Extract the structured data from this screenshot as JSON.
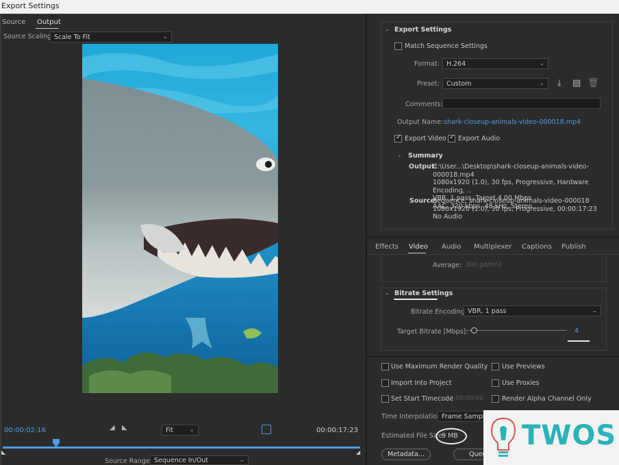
{
  "window": {
    "title": "Export Settings"
  },
  "source_panel": {
    "tabs": [
      "Source",
      "Output"
    ],
    "source_scaling_label": "Source Scaling:",
    "source_scaling_value": "Scale To Fit",
    "timecode_current": "00:00:02:16",
    "fit_value": "Fit",
    "timecode_end": "00:00:17:23",
    "source_range_label": "Source Range:",
    "source_range_value": "Sequence In/Out",
    "playhead_fraction": 0.15
  },
  "export_settings": {
    "header": "Export Settings",
    "match_sequence_settings": "Match Sequence Settings",
    "format_label": "Format:",
    "format_value": "H.264",
    "preset_label": "Preset:",
    "preset_value": "Custom",
    "comments_label": "Comments:",
    "comments_value": "",
    "output_name_label": "Output Name:",
    "output_name_value": "shark-closeup-animals-video-000018.mp4",
    "export_video_label": "Export Video",
    "export_video_checked": true,
    "export_audio_label": "Export Audio",
    "export_audio_checked": true,
    "summary_header": "Summary",
    "summary_output_label": "Output:",
    "summary_output_lines": [
      "C:\\User...\\Desktop\\shark-closeup-animals-video-000018.mp4",
      "1080x1920 (1.0), 30 fps, Progressive, Hardware Encoding, ..",
      "VBR, 1 pass, Target 4.00 Mbps",
      "AAC, 320 kbps, 48 kHz, Stereo"
    ],
    "summary_source_label": "Source:",
    "summary_source_lines": [
      "Sequence, shark-closeup-animals-video-000018",
      "1080x1920 (1.0), 30 fps, Progressive, 00:00:17:23",
      "No Audio"
    ]
  },
  "settings_tabs": [
    "Effects",
    "Video",
    "Audio",
    "Multiplexer",
    "Captions",
    "Publish"
  ],
  "video_settings": {
    "average_label": "Average:",
    "average_value": "300 gd/m²2",
    "bitrate_header": "Bitrate Settings",
    "bitrate_encoding_label": "Bitrate Encoding:",
    "bitrate_encoding_value": "VBR, 1 pass",
    "target_bitrate_label": "Target Bitrate [Mbps]:",
    "target_bitrate_value": "4"
  },
  "bottom_options": {
    "use_max_render_quality": "Use Maximum Render Quality",
    "use_previews": "Use Previews",
    "import_into_project": "Import Into Project",
    "use_proxies": "Use Proxies",
    "set_start_timecode": "Set Start Timecode",
    "start_timecode_value": "00:00:00:00",
    "render_alpha_only": "Render Alpha Channel Only",
    "time_interpolation_label": "Time Interpolation:",
    "time_interpolation_value": "Frame Sampling",
    "estimated_file_size_label": "Estimated File Size:",
    "estimated_file_size_value": "9 MB",
    "metadata_button": "Metadata...",
    "queue_button": "Queue"
  },
  "watermark": {
    "text": "TWOS",
    "color": "#2ab3b8"
  },
  "colors": {
    "accent_blue": "#4e9be7",
    "panel_bg": "#2b2b2b"
  }
}
